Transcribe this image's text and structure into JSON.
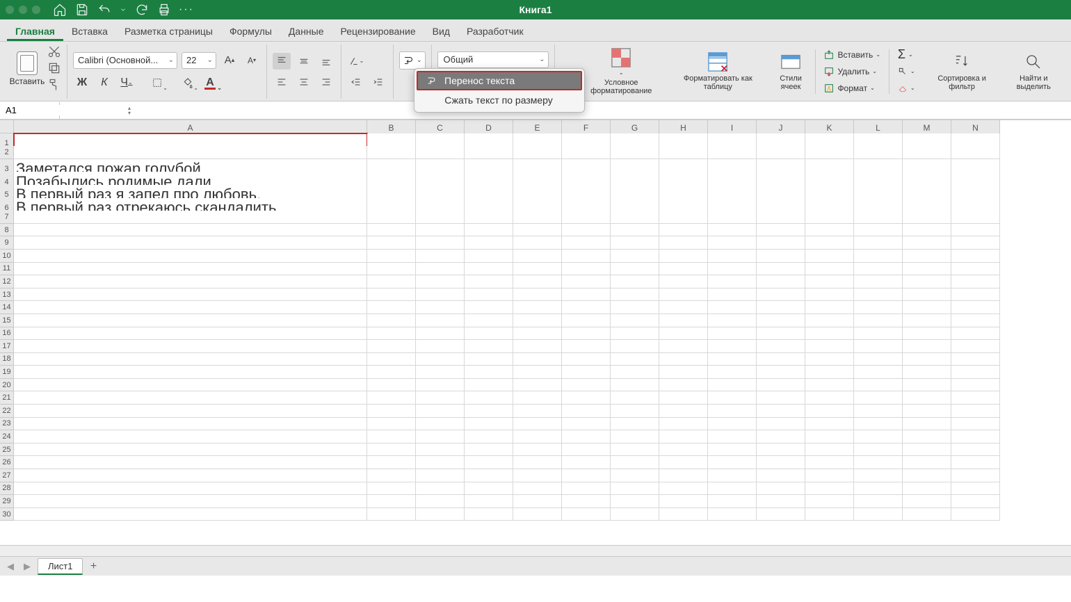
{
  "title": "Книга1",
  "tabs": [
    "Главная",
    "Вставка",
    "Разметка страницы",
    "Формулы",
    "Данные",
    "Рецензирование",
    "Вид",
    "Разработчик"
  ],
  "active_tab": 0,
  "ribbon": {
    "paste_label": "Вставить",
    "font_name": "Calibri (Основной...",
    "font_size": "22",
    "number_format": "Общий",
    "cond_fmt": "Условное форматирование",
    "fmt_table": "Форматировать как таблицу",
    "cell_styles": "Стили ячеек",
    "insert": "Вставить",
    "delete": "Удалить",
    "format": "Формат",
    "sort_filter": "Сортировка и фильтр",
    "find_select": "Найти и выделить"
  },
  "wrap_dropdown": {
    "item1": "Перенос текста",
    "item2": "Сжать текст по размеру"
  },
  "name_box": "A1",
  "columns": [
    "A",
    "B",
    "C",
    "D",
    "E",
    "F",
    "G",
    "H",
    "I",
    "J",
    "K",
    "L",
    "M",
    "N"
  ],
  "rows": 30,
  "cell_data": {
    "3": "Заметался пожар голубой,",
    "4": "Позабылись родимые дали.",
    "5": "В первый раз я запел про любовь,",
    "6": "В первый раз отрекаюсь скандалить."
  },
  "selected_cell": "A1",
  "sheet_tab": "Лист1"
}
